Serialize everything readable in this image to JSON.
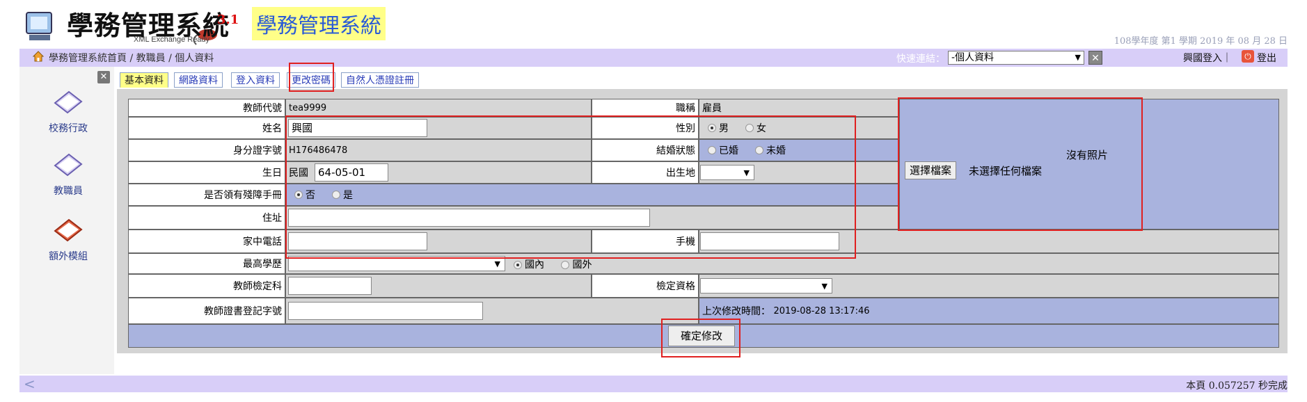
{
  "header": {
    "logo_title": "學務管理系統",
    "logo_version": "3.1",
    "logo_subtitle": "XML Exchange Ready",
    "app_title": "學務管理系統",
    "status": "108學年度 第1 學期 2019 年 08 月 28 日"
  },
  "nav": {
    "breadcrumb_home": "學務管理系統首頁",
    "breadcrumb_sep1": " / ",
    "breadcrumb_2": "教職員",
    "breadcrumb_sep2": " / ",
    "breadcrumb_3": "個人資料",
    "quick_label": "快速連結：",
    "quick_value": "-個人資料",
    "user_label": "興國登入｜",
    "logout_label": "登出"
  },
  "sidebar": {
    "items": [
      {
        "label": "校務行政"
      },
      {
        "label": "教職員"
      },
      {
        "label": "額外模組"
      }
    ]
  },
  "tabs": [
    {
      "label": "基本資料"
    },
    {
      "label": "網路資料"
    },
    {
      "label": "登入資料"
    },
    {
      "label": "更改密碼"
    },
    {
      "label": "自然人憑證註冊"
    }
  ],
  "form": {
    "teacher_code_label": "教師代號",
    "teacher_code_value": "tea9999",
    "title_label": "職稱",
    "title_value": "雇員",
    "name_label": "姓名",
    "name_value": "興國",
    "gender_label": "性別",
    "gender_male": "男",
    "gender_female": "女",
    "id_label": "身分證字號",
    "id_value": "H176486478",
    "marital_label": "結婚狀態",
    "marital_married": "已婚",
    "marital_single": "未婚",
    "birthday_label": "生日",
    "birthday_era": "民國",
    "birthday_value": "64-05-01",
    "birthplace_label": "出生地",
    "disability_label": "是否領有殘障手冊",
    "disability_no": "否",
    "disability_yes": "是",
    "address_label": "住址",
    "home_phone_label": "家中電話",
    "mobile_label": "手機",
    "education_label": "最高學歷",
    "edu_domestic": "國內",
    "edu_foreign": "國外",
    "cert_subject_label": "教師檢定科",
    "cert_qual_label": "檢定資格",
    "cert_reg_label": "教師證書登記字號",
    "last_modified_label": "上次修改時間：",
    "last_modified_value": "2019-08-28 13:17:46",
    "no_photo": "沒有照片",
    "choose_file": "選擇檔案",
    "no_file": "未選擇任何檔案",
    "submit": "確定修改"
  },
  "footer": {
    "arrow": "<",
    "timing": "本頁 0.057257 秒完成"
  },
  "colors": {
    "nav_bg": "#d8cef8",
    "row_blue": "#a9b3de",
    "row_gray": "#d6d6d6",
    "highlight": "#e02020",
    "title_bg": "#ffff88",
    "title_fg": "#2a5bd6"
  }
}
